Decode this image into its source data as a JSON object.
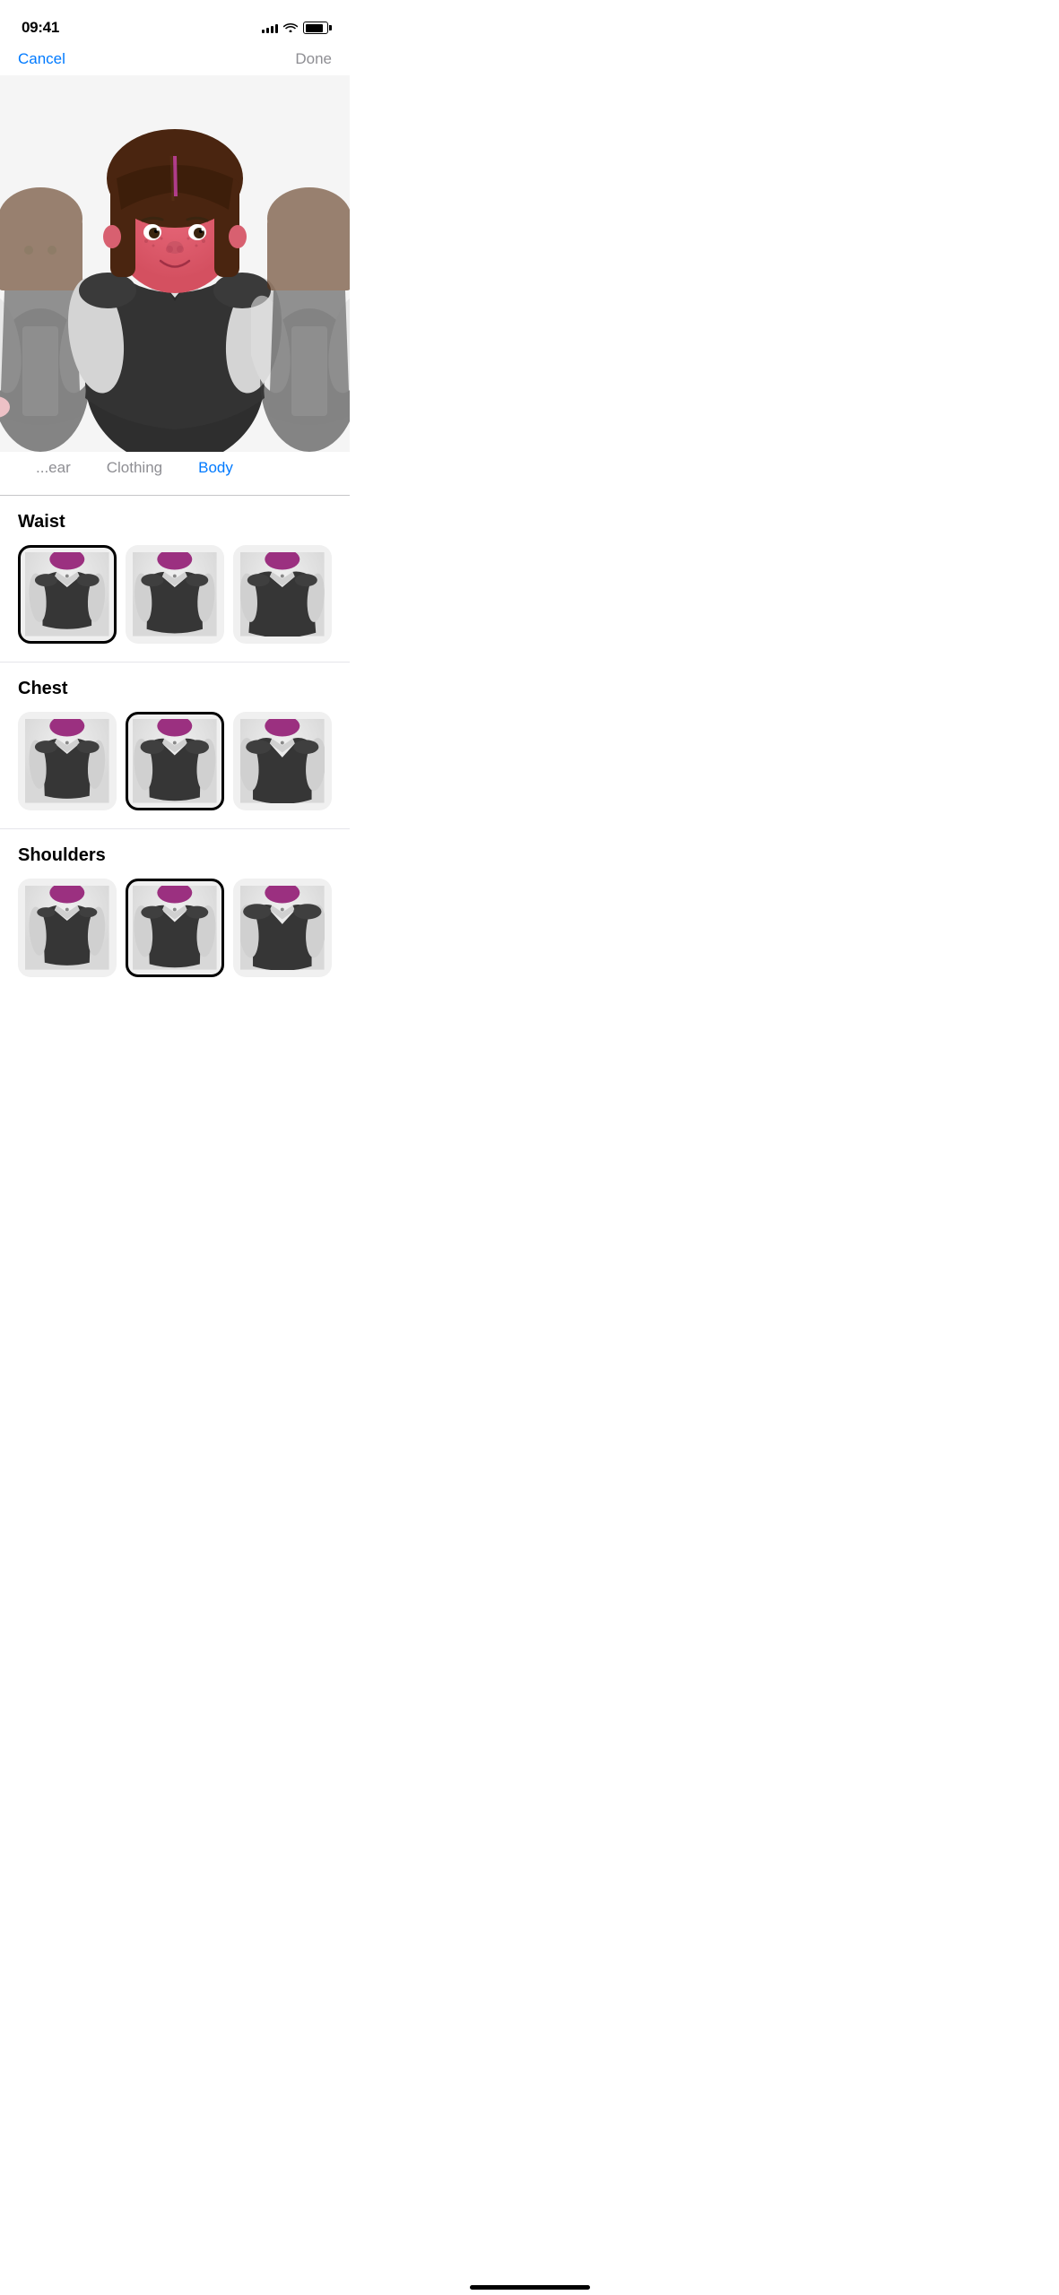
{
  "statusBar": {
    "time": "09:41",
    "signalBars": [
      4,
      6,
      8,
      10,
      12
    ],
    "batteryPercent": 85
  },
  "navBar": {
    "cancelLabel": "Cancel",
    "doneLabel": "Done"
  },
  "tabs": [
    {
      "id": "headwear",
      "label": "...ear",
      "active": false
    },
    {
      "id": "clothing",
      "label": "Clothing",
      "active": false
    },
    {
      "id": "body",
      "label": "Body",
      "active": true
    }
  ],
  "sections": [
    {
      "id": "waist",
      "title": "Waist",
      "options": [
        {
          "id": "waist-1",
          "selected": true
        },
        {
          "id": "waist-2",
          "selected": false
        },
        {
          "id": "waist-3",
          "selected": false
        }
      ]
    },
    {
      "id": "chest",
      "title": "Chest",
      "options": [
        {
          "id": "chest-1",
          "selected": false
        },
        {
          "id": "chest-2",
          "selected": true
        },
        {
          "id": "chest-3",
          "selected": false
        }
      ]
    },
    {
      "id": "shoulders",
      "title": "Shoulders",
      "options": [
        {
          "id": "shoulders-1",
          "selected": false
        },
        {
          "id": "shoulders-2",
          "selected": true
        },
        {
          "id": "shoulders-3",
          "selected": false
        }
      ]
    }
  ],
  "homeIndicator": {
    "visible": true
  }
}
